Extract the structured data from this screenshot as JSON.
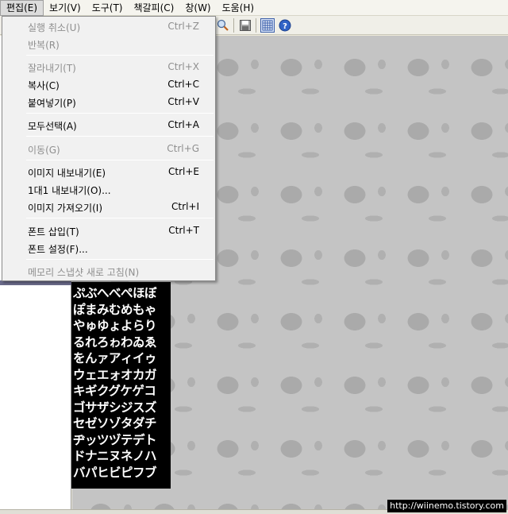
{
  "menubar": {
    "items": [
      {
        "label": "편집(E)",
        "open": true
      },
      {
        "label": "보기(V)"
      },
      {
        "label": "도구(T)"
      },
      {
        "label": "책갈피(C)"
      },
      {
        "label": "창(W)"
      },
      {
        "label": "도움(H)"
      }
    ]
  },
  "edit_menu": {
    "undo": {
      "label": "실행 취소(U)",
      "shortcut": "Ctrl+Z",
      "enabled": false
    },
    "redo": {
      "label": "반복(R)",
      "shortcut": "",
      "enabled": false
    },
    "cut": {
      "label": "잘라내기(T)",
      "shortcut": "Ctrl+X",
      "enabled": false
    },
    "copy": {
      "label": "복사(C)",
      "shortcut": "Ctrl+C",
      "enabled": true
    },
    "paste": {
      "label": "붙여넣기(P)",
      "shortcut": "Ctrl+V",
      "enabled": true
    },
    "select_all": {
      "label": "모두선택(A)",
      "shortcut": "Ctrl+A",
      "enabled": true
    },
    "move": {
      "label": "이동(G)",
      "shortcut": "Ctrl+G",
      "enabled": false
    },
    "export_image": {
      "label": "이미지 내보내기(E)",
      "shortcut": "Ctrl+E",
      "enabled": true
    },
    "export_1to1": {
      "label": "1대1 내보내기(O)...",
      "shortcut": "",
      "enabled": true
    },
    "import_image": {
      "label": "이미지 가져오기(I)",
      "shortcut": "Ctrl+I",
      "enabled": true
    },
    "insert_font": {
      "label": "폰트 삽입(T)",
      "shortcut": "Ctrl+T",
      "enabled": true
    },
    "font_settings": {
      "label": "폰트 설정(F)...",
      "shortcut": "",
      "enabled": true
    },
    "refresh_snapshot": {
      "label": "메모리 스냅샷 새로 고침(N)",
      "shortcut": "",
      "enabled": false
    }
  },
  "toolbar": {
    "icons": [
      "zoom-icon",
      "save-icon",
      "grid-icon",
      "help-icon"
    ]
  },
  "glyph_sheet": {
    "rows": [
      "ぷぶへべぺほぼ",
      "ぽまみむめもゃ",
      "やゅゆょよらり",
      "るれろゎわゐゑ",
      "をんァアィイゥ",
      "ウェエォオカガ",
      "キギクグケゲコ",
      "ゴサザシジスズ",
      "セゼソゾタダチ",
      "ヂッツヅテデト",
      "ドナニヌネノハ",
      "バパヒビピフブ"
    ]
  },
  "watermark": "http://wiinemo.tistory.com"
}
